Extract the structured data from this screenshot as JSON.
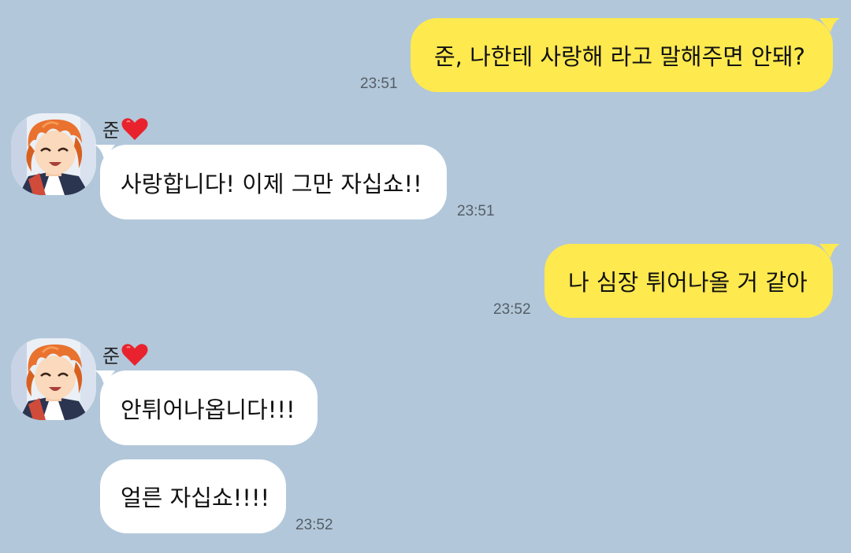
{
  "chat": {
    "messages": [
      {
        "text": "준, 나한테 사랑해 라고 말해주면 안돼?",
        "time": "23:51"
      },
      {
        "sender": "준",
        "text": "사랑합니다! 이제 그만 자십쇼!!",
        "time": "23:51"
      },
      {
        "text": "나 심장 튀어나올 거 같아",
        "time": "23:52"
      },
      {
        "sender": "준",
        "text": "안튀어나옵니다!!!"
      },
      {
        "text": "얼른 자십쇼!!!!",
        "time": "23:52"
      }
    ]
  },
  "colors": {
    "background": "#b2c7da",
    "my_bubble": "#fee94f",
    "their_bubble": "#ffffff"
  },
  "icons": {
    "sender_heart": "heart-icon",
    "avatar": "avatar-orange-hair"
  }
}
